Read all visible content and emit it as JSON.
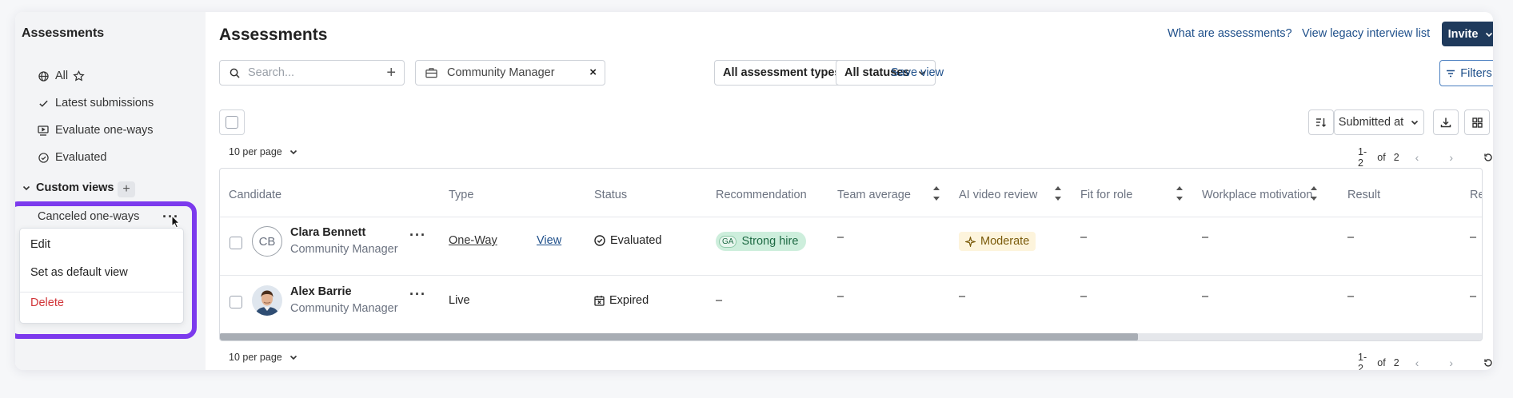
{
  "sidebar": {
    "title": "Assessments",
    "items": [
      {
        "label": "All",
        "icon": "globe-icon"
      },
      {
        "label": "Latest submissions",
        "icon": "check-icon"
      },
      {
        "label": "Evaluate one-ways",
        "icon": "video-icon"
      },
      {
        "label": "Evaluated",
        "icon": "check-circle-icon"
      }
    ],
    "custom_views_label": "Custom views",
    "custom_views": [
      {
        "label": "Canceled one-ways"
      }
    ],
    "context_menu": {
      "edit": "Edit",
      "set_default": "Set as default view",
      "delete": "Delete"
    }
  },
  "header": {
    "title": "Assessments",
    "what_link": "What are assessments?",
    "legacy_link": "View legacy interview list",
    "invite_label": "Invite"
  },
  "filters": {
    "search_placeholder": "Search...",
    "job_chip": "Community Manager",
    "types_label": "All assessment types",
    "statuses_label": "All statuses",
    "save_view": "Save view",
    "filters_button": "Filters"
  },
  "toolbar": {
    "sort_label": "Submitted at",
    "per_page": "10 per page",
    "range": "1-2",
    "of_label": "of",
    "total": "2"
  },
  "table": {
    "headers": {
      "candidate": "Candidate",
      "type": "Type",
      "status": "Status",
      "recommendation": "Recommendation",
      "team_average": "Team average",
      "ai_video_review": "AI video review",
      "fit_for_role": "Fit for role",
      "workplace_motivation": "Workplace motivation",
      "result": "Result",
      "more": "Re"
    },
    "rows": [
      {
        "initials": "CB",
        "name": "Clara Bennett",
        "role": "Community Manager",
        "type": "One-Way",
        "view": "View",
        "status": "Evaluated",
        "recommendation_initials": "GA",
        "recommendation": "Strong hire",
        "team_average": "–",
        "ai_video_review": "Moderate",
        "fit_for_role": "–",
        "workplace_motivation": "–",
        "result": "–",
        "more": "–"
      },
      {
        "name": "Alex Barrie",
        "role": "Community Manager",
        "type": "Live",
        "status": "Expired",
        "recommendation": "–",
        "team_average": "–",
        "ai_video_review": "–",
        "fit_for_role": "–",
        "workplace_motivation": "–",
        "result": "–",
        "more": "–"
      }
    ]
  },
  "colors": {
    "highlight": "#7c3aed",
    "primary": "#1f3a5c",
    "link": "#1e4f8a",
    "danger": "#d13438",
    "strong_hire_bg": "#cdeedc",
    "moderate_bg": "#fdf4dc"
  }
}
